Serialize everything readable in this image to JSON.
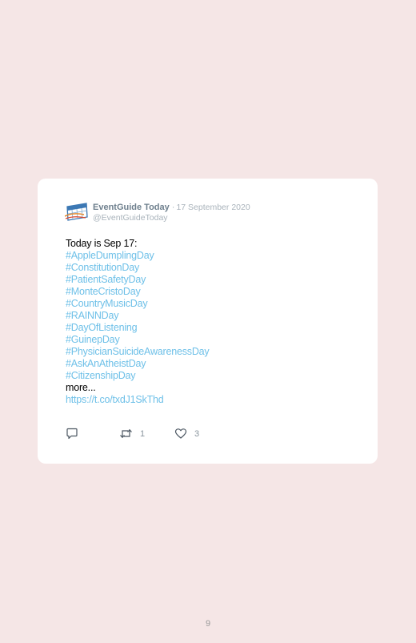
{
  "tweet": {
    "display_name": "EventGuide Today",
    "separator": "·",
    "date": "17 September 2020",
    "handle": "@EventGuideToday",
    "lines": [
      {
        "text": "Today is Sep 17:",
        "kind": "text"
      },
      {
        "text": "#AppleDumplingDay",
        "kind": "hashtag"
      },
      {
        "text": "#ConstitutionDay",
        "kind": "hashtag"
      },
      {
        "text": "#PatientSafetyDay",
        "kind": "hashtag"
      },
      {
        "text": "#MonteCristoDay",
        "kind": "hashtag"
      },
      {
        "text": "#CountryMusicDay",
        "kind": "hashtag"
      },
      {
        "text": "#RAINNDay",
        "kind": "hashtag"
      },
      {
        "text": "#DayOfListening",
        "kind": "hashtag"
      },
      {
        "text": "#GuinepDay",
        "kind": "hashtag"
      },
      {
        "text": "#PhysicianSuicideAwarenessDay",
        "kind": "hashtag"
      },
      {
        "text": "#AskAnAtheistDay",
        "kind": "hashtag"
      },
      {
        "text": "#CitizenshipDay",
        "kind": "hashtag"
      },
      {
        "text": "more...",
        "kind": "text"
      },
      {
        "text": "https://t.co/txdJ1SkThd",
        "kind": "link"
      }
    ],
    "actions": {
      "reply_icon": "reply-icon",
      "retweet_icon": "retweet-icon",
      "retweet_count": "1",
      "like_icon": "heart-icon",
      "like_count": "3"
    }
  },
  "page_number": "9",
  "colors": {
    "background": "#f5e6e6",
    "card": "#ffffff",
    "link": "#6ec0e8",
    "muted": "#a9b3bb",
    "name": "#6e7f8d"
  }
}
